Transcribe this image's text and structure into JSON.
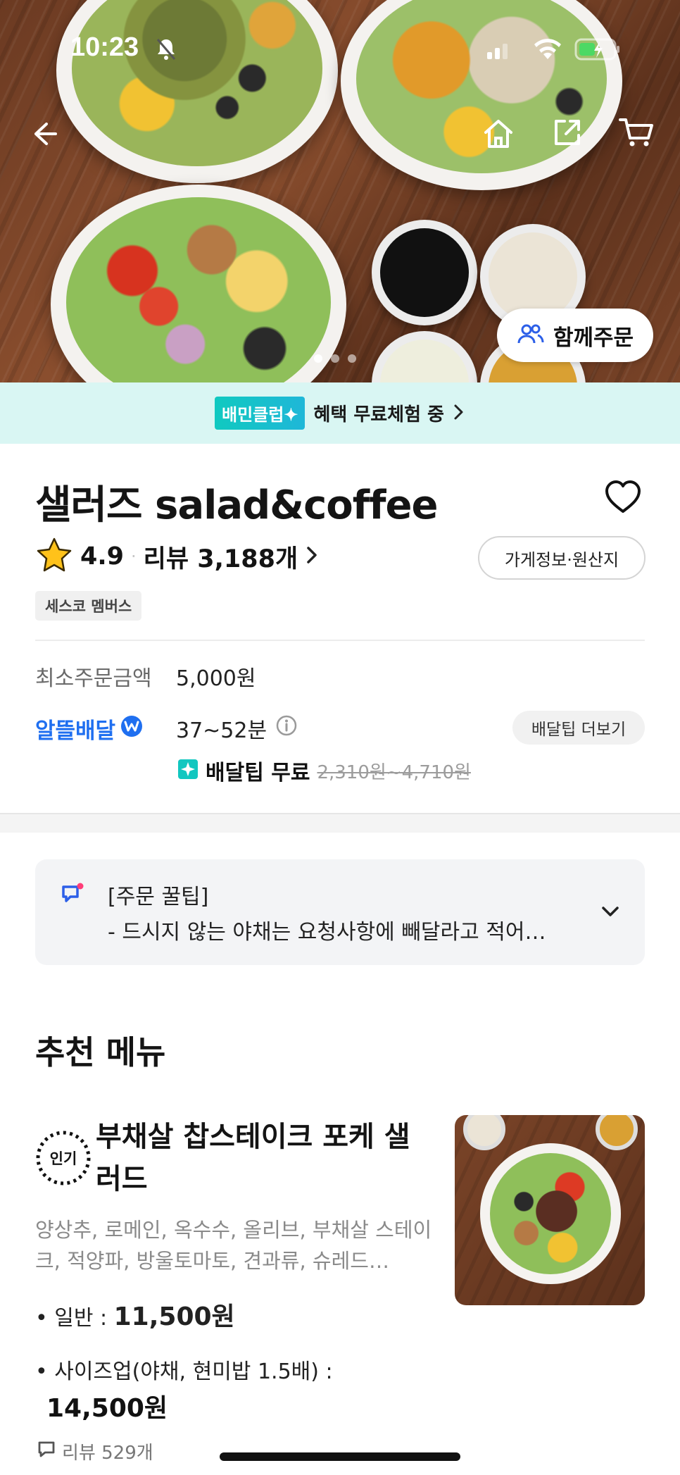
{
  "status_bar": {
    "time": "10:23"
  },
  "hero": {
    "group_order_label": "함께주문",
    "carousel_total": 3,
    "carousel_active": 1
  },
  "club_banner": {
    "badge": "배민클럽✦",
    "text": "혜택 무료체험 중"
  },
  "store": {
    "name": "샐러즈 salad&coffee",
    "rating": "4.9",
    "review_label": "리뷰 3,188개",
    "info_button": "가게정보·원산지",
    "member_badge": "세스코 멤버스"
  },
  "order_info": {
    "min_order_label": "최소주문금액",
    "min_order_value": "5,000원",
    "delivery_brand": "알뜰배달",
    "delivery_time": "37~52분",
    "tip_more": "배달팁 더보기",
    "free_tip_label": "배달팁 무료",
    "original_tip": "2,310원~4,710원"
  },
  "order_tip": {
    "title": "[주문 꿀팁]",
    "text": "- 드시지 않는 야채는 요청사항에 빼달라고 적어…"
  },
  "recommended": {
    "section_title": "추천 메뉴",
    "item": {
      "badge": "인기",
      "name": "부채살 찹스테이크 포케 샐러드",
      "description": "양상추, 로메인, 옥수수, 올리브, 부채살 스테이크, 적양파, 방울토마토, 견과류, 슈레드…",
      "price_regular_label": "• 일반 : ",
      "price_regular": "11,500원",
      "price_size_label": "• 사이즈업(야채, 현미밥 1.5배) :",
      "price_size": "14,500원",
      "review_count": "리뷰 529개"
    }
  },
  "colors": {
    "club_bg": "#d9f6f3",
    "accent_blue": "#1f6ff0",
    "club_teal": "#10c9c0"
  },
  "icons": [
    "back-arrow-icon",
    "home-icon",
    "share-icon",
    "cart-icon",
    "group-people-icon",
    "heart-icon",
    "star-icon",
    "chevron-right-icon",
    "info-icon",
    "delivery-coin-icon",
    "club-sparkle-icon",
    "tip-chat-icon",
    "chevron-down-icon",
    "comment-icon"
  ]
}
